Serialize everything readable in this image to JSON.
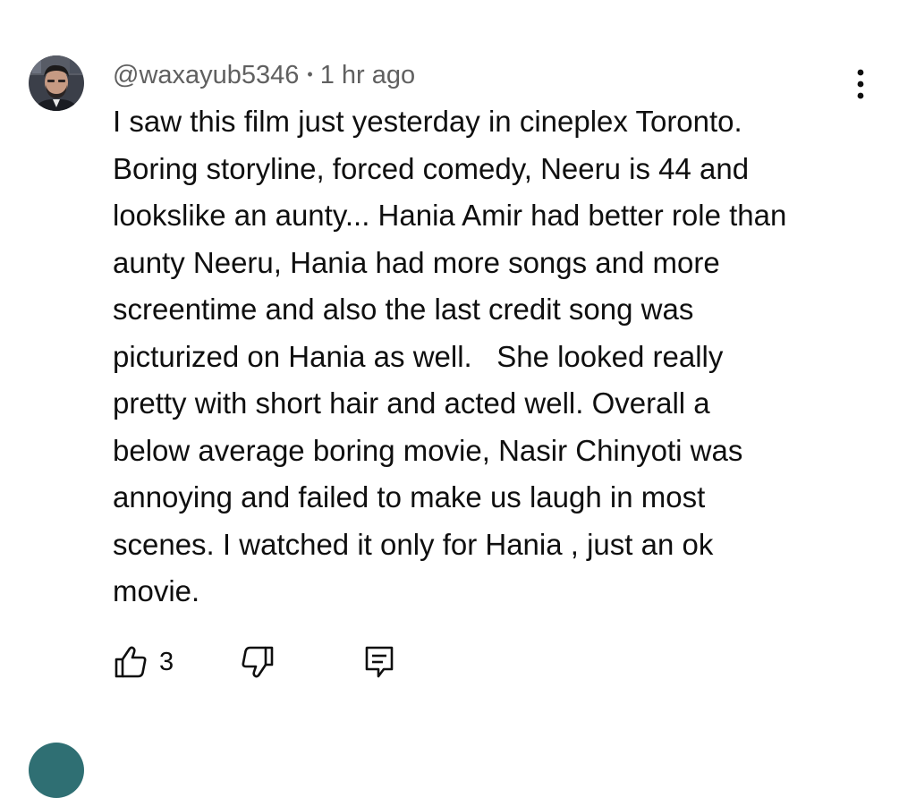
{
  "comment": {
    "author": "@waxayub5346",
    "separator": "•",
    "time": "1 hr ago",
    "text": "I saw this film just yesterday in cineplex Toronto.\nBoring storyline, forced comedy, Neeru is 44 and\nlookslike an aunty... Hania Amir had better role than\naunty Neeru, Hania had more songs and more\nscreentime and also the last credit song was\npicturized on Hania as well.   She looked really\npretty with short hair and acted well. Overall a\nbelow average boring movie, Nasir Chinyoti was\nannoying and failed to make us laugh in most\nscenes. I watched it only for Hania , just an ok\nmovie.",
    "like_count": "3"
  },
  "icons": {
    "more": "more-vertical-icon",
    "like": "thumbs-up-icon",
    "dislike": "thumbs-down-icon",
    "reply": "reply-comment-icon"
  },
  "colors": {
    "text_primary": "#0f0f0f",
    "text_secondary": "#606060",
    "background": "#ffffff"
  }
}
